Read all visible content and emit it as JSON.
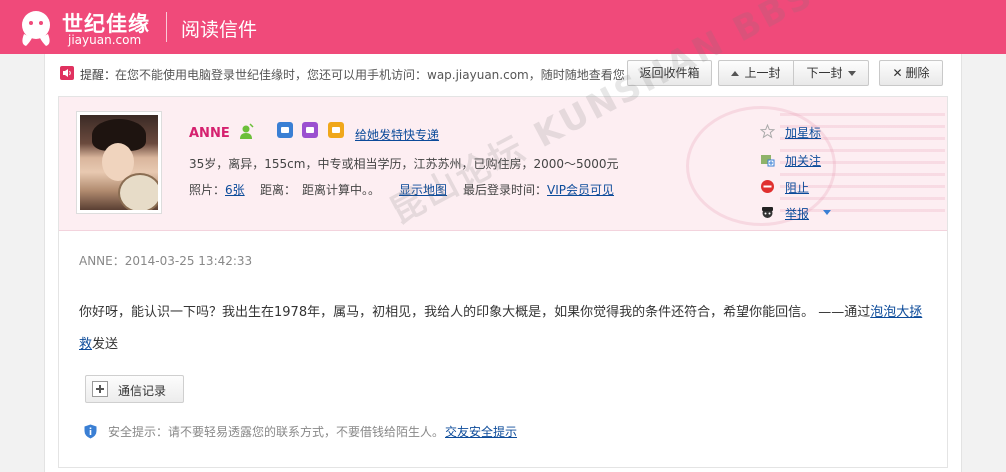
{
  "header": {
    "logo_cn": "世纪佳缘",
    "logo_en": "jiayuan.com",
    "page_title": "阅读信件"
  },
  "notice": {
    "label": "提醒：",
    "text": "在您不能使用电脑登录世纪佳缘时，您还可以用手机访问：wap.jiayuan.com，随时随地查看您"
  },
  "toolbar": {
    "back_label": "返回收件箱",
    "prev_label": "上一封",
    "next_label": "下一封",
    "delete_label": "删除"
  },
  "profile": {
    "name": "ANNE",
    "express_link": "给她发特快专递",
    "info": "35岁，离异，155cm，中专或相当学历，江苏苏州，已购住房，2000～5000元",
    "photos_label": "照片：",
    "photos_count": "6张",
    "distance_label": "距离：",
    "distance_value": "距离计算中。。",
    "map_link": "显示地图",
    "last_login_label": "最后登录时间：",
    "last_login_value": "VIP会员可见"
  },
  "actions": {
    "star": "加星标",
    "follow": "加关注",
    "block": "阻止",
    "report": "举报"
  },
  "watermark": "昆山论坛 KUNSHAN BBS",
  "message": {
    "meta": "ANNE：2014-03-25 13:42:33",
    "body": "你好呀，能认识一下吗？我出生在1978年，属马，初相见，我给人的印象大概是，如果你觉得我的条件还符合，希望你能回信。 ——通过",
    "via_link": "泡泡大拯救",
    "via_suffix": "发送"
  },
  "history_button": "通信记录",
  "safety": {
    "text": "安全提示：请不要轻易透露您的联系方式，不要借钱给陌生人。",
    "link": "交友安全提示"
  },
  "colors": {
    "brand": "#f04a7a",
    "name": "#d5216f",
    "link": "#0c4b9a",
    "profile_band": "#fdeef2"
  }
}
